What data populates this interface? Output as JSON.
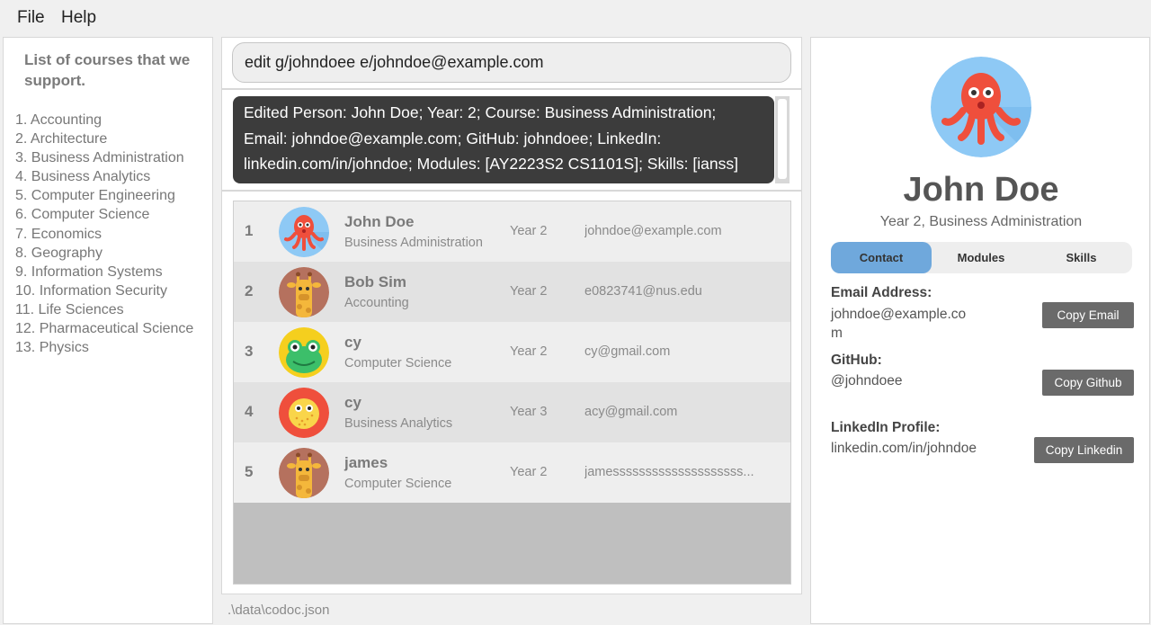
{
  "menu": {
    "file": "File",
    "help": "Help"
  },
  "sidebar": {
    "title": "List of courses that we support.",
    "courses": [
      "1. Accounting",
      "2. Architecture",
      "3. Business Administration",
      "4. Business Analytics",
      "5. Computer Engineering",
      "6. Computer Science",
      "7. Economics",
      "8. Geography",
      "9. Information Systems",
      "10. Information Security",
      "11. Life Sciences",
      "12. Pharmaceutical Science",
      "13. Physics"
    ]
  },
  "command": {
    "value": "edit g/johndoee e/johndoe@example.com"
  },
  "result": {
    "text": "Edited Person: John Doe; Year: 2; Course: Business Administration; Email: johndoe@example.com; GitHub: johndoee; LinkedIn: linkedin.com/in/johndoe; Modules: [AY2223S2 CS1101S]; Skills: [ianss]"
  },
  "people": [
    {
      "index": "1",
      "name": "John Doe",
      "course": "Business Administration",
      "year": "Year 2",
      "email": "johndoe@example.com",
      "avatar": "octopus-avatar"
    },
    {
      "index": "2",
      "name": "Bob Sim",
      "course": "Accounting",
      "year": "Year 2",
      "email": "e0823741@nus.edu",
      "avatar": "giraffe-avatar"
    },
    {
      "index": "3",
      "name": "cy",
      "course": "Computer Science",
      "year": "Year 2",
      "email": "cy@gmail.com",
      "avatar": "frog-avatar"
    },
    {
      "index": "4",
      "name": "cy",
      "course": "Business Analytics",
      "year": "Year 3",
      "email": "acy@gmail.com",
      "avatar": "pufferfish-avatar"
    },
    {
      "index": "5",
      "name": "james",
      "course": "Computer Science",
      "year": "Year 2",
      "email": "jamessssssssssssssssssss...",
      "avatar": "giraffe-avatar"
    }
  ],
  "status": {
    "path": ".\\data\\codoc.json"
  },
  "profile": {
    "name": "John Doe",
    "subtitle": "Year 2, Business Administration",
    "tabs": {
      "contact": "Contact",
      "modules": "Modules",
      "skills": "Skills"
    },
    "email_label": "Email Address:",
    "email_value": "johndoe@example.com",
    "github_label": "GitHub:",
    "github_value": "@johndoee",
    "linkedin_label": "LinkedIn Profile:",
    "linkedin_value": "linkedin.com/in/johndoe",
    "copy_email": "Copy Email",
    "copy_github": "Copy Github",
    "copy_linkedin": "Copy Linkedin"
  },
  "colors": {
    "accent_tab": "#6fa8dc",
    "result_bg": "#3c3c3c",
    "copy_button": "#6a6a6a"
  }
}
